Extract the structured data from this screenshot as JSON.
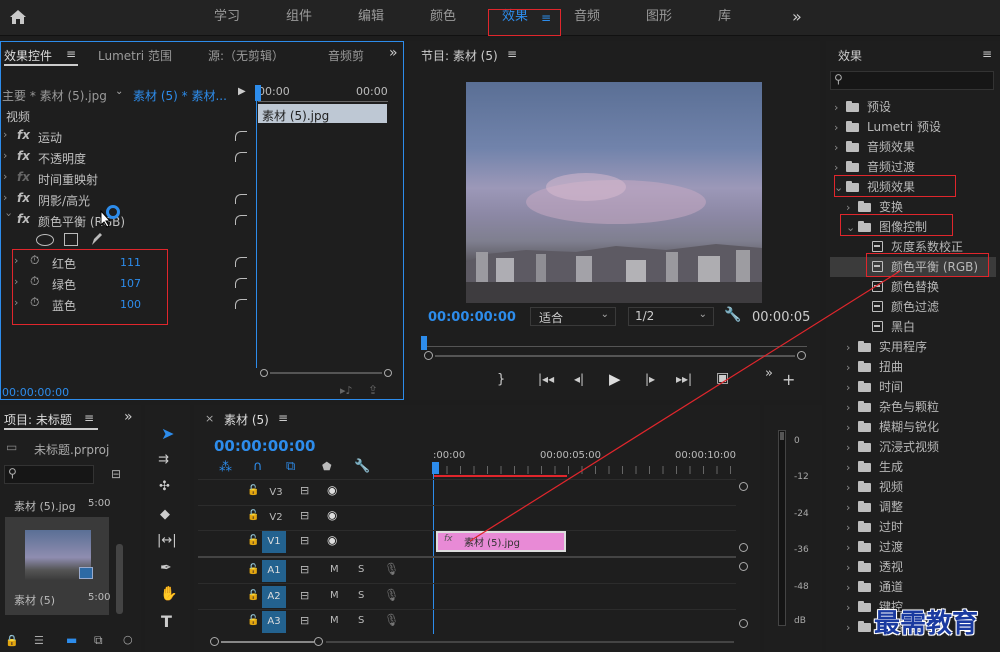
{
  "topbar": {
    "tabs": [
      "学习",
      "组件",
      "编辑",
      "颜色",
      "效果",
      "音频",
      "图形",
      "库"
    ],
    "active_tab": "效果",
    "more_icon": "»"
  },
  "effect_controls": {
    "tabs": [
      "效果控件",
      "Lumetri 范围",
      "源:（无剪辑）",
      "音频剪"
    ],
    "source_row": {
      "master": "主要 * 素材 (5).jpg",
      "clip": "素材 (5) * 素材...",
      "time": "00:00",
      "time_end": "00:00"
    },
    "clip_label": "素材 (5).jpg",
    "section": "视频",
    "effects": [
      "运动",
      "不透明度",
      "时间重映射",
      "阴影/高光",
      "颜色平衡 (RGB)"
    ],
    "params": [
      {
        "label": "红色",
        "value": "111"
      },
      {
        "label": "绿色",
        "value": "107"
      },
      {
        "label": "蓝色",
        "value": "100"
      }
    ],
    "timecode": "00:00:00:00"
  },
  "program": {
    "title": "节目: 素材 (5)",
    "timecode": "00:00:00:00",
    "fit": "适合",
    "quality": "1/2",
    "duration": "00:00:05"
  },
  "effects_panel": {
    "title": "效果",
    "search_placeholder": "",
    "items": [
      {
        "label": "预设",
        "type": "star-folder",
        "level": 0,
        "expanded": false
      },
      {
        "label": "Lumetri 预设",
        "type": "star-folder",
        "level": 0,
        "expanded": false
      },
      {
        "label": "音频效果",
        "type": "folder",
        "level": 0,
        "expanded": false
      },
      {
        "label": "音频过渡",
        "type": "folder",
        "level": 0,
        "expanded": false
      },
      {
        "label": "视频效果",
        "type": "folder",
        "level": 0,
        "expanded": true
      },
      {
        "label": "变换",
        "type": "folder",
        "level": 1,
        "expanded": false
      },
      {
        "label": "图像控制",
        "type": "folder",
        "level": 1,
        "expanded": true
      },
      {
        "label": "灰度系数校正",
        "type": "fx",
        "level": 2
      },
      {
        "label": "颜色平衡 (RGB)",
        "type": "fx",
        "level": 2,
        "selected": true
      },
      {
        "label": "颜色替换",
        "type": "fx",
        "level": 2
      },
      {
        "label": "颜色过滤",
        "type": "fx",
        "level": 2
      },
      {
        "label": "黑白",
        "type": "fx",
        "level": 2
      },
      {
        "label": "实用程序",
        "type": "folder",
        "level": 1
      },
      {
        "label": "扭曲",
        "type": "folder",
        "level": 1
      },
      {
        "label": "时间",
        "type": "folder",
        "level": 1
      },
      {
        "label": "杂色与颗粒",
        "type": "folder",
        "level": 1
      },
      {
        "label": "模糊与锐化",
        "type": "folder",
        "level": 1
      },
      {
        "label": "沉浸式视频",
        "type": "folder",
        "level": 1
      },
      {
        "label": "生成",
        "type": "folder",
        "level": 1
      },
      {
        "label": "视频",
        "type": "folder",
        "level": 1
      },
      {
        "label": "调整",
        "type": "folder",
        "level": 1
      },
      {
        "label": "过时",
        "type": "folder",
        "level": 1
      },
      {
        "label": "过渡",
        "type": "folder",
        "level": 1
      },
      {
        "label": "透视",
        "type": "folder",
        "level": 1
      },
      {
        "label": "通道",
        "type": "folder",
        "level": 1
      },
      {
        "label": "键控",
        "type": "folder",
        "level": 1
      },
      {
        "label": "风格化",
        "type": "folder",
        "level": 1
      }
    ]
  },
  "project": {
    "title": "项目: 未标题",
    "file": "未标题.prproj",
    "items": [
      {
        "name": "素材 (5).jpg",
        "duration": "5:00"
      },
      {
        "name": "素材 (5)",
        "duration": "5:00"
      }
    ]
  },
  "timeline": {
    "title": "素材 (5)",
    "timecode": "00:00:00:00",
    "ruler": [
      ":00:00",
      "00:00:05:00",
      "00:00:10:00"
    ],
    "video_tracks": [
      "V3",
      "V2",
      "V1"
    ],
    "audio_tracks": [
      "A1",
      "A2",
      "A3"
    ],
    "clip": "素材 (5).jpg",
    "m_label": "M",
    "s_label": "S"
  },
  "meter": {
    "ticks": [
      "0",
      "-12",
      "-24",
      "-36",
      "-48",
      "dB"
    ]
  },
  "watermark": "最需教育",
  "colors": {
    "accent_blue": "#2d8ceb",
    "red_highlight": "#e0262c",
    "clip_pink": "#e88ad6"
  }
}
